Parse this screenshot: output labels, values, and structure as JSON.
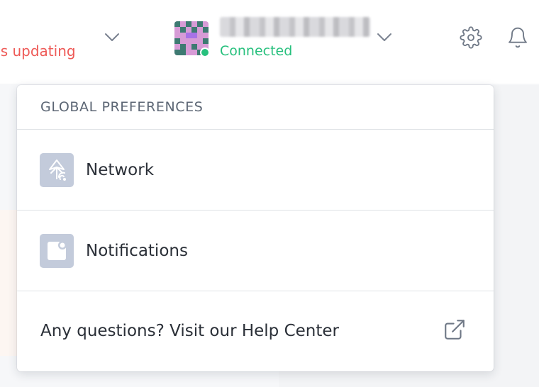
{
  "header": {
    "sync_status": "ds updating",
    "account": {
      "name": "███ ██ ██",
      "connection_status": "Connected"
    },
    "icons": {
      "status_chevron": "chevron-down-icon",
      "account_chevron": "chevron-down-icon",
      "settings": "gear-icon",
      "notifications": "bell-icon"
    }
  },
  "dropdown": {
    "section_title": "GLOBAL PREFERENCES",
    "items": [
      {
        "label": "Network",
        "icon": "network-icon"
      },
      {
        "label": "Notifications",
        "icon": "notifications-icon"
      }
    ],
    "help": {
      "label": "Any questions? Visit our Help Center",
      "icon": "external-link-icon"
    }
  },
  "colors": {
    "status_warning": "#ee5a57",
    "connected_green": "#27c07d",
    "icon_tile": "#c3cbdb",
    "text_primary": "#2b3038",
    "text_muted": "#5c6674"
  }
}
